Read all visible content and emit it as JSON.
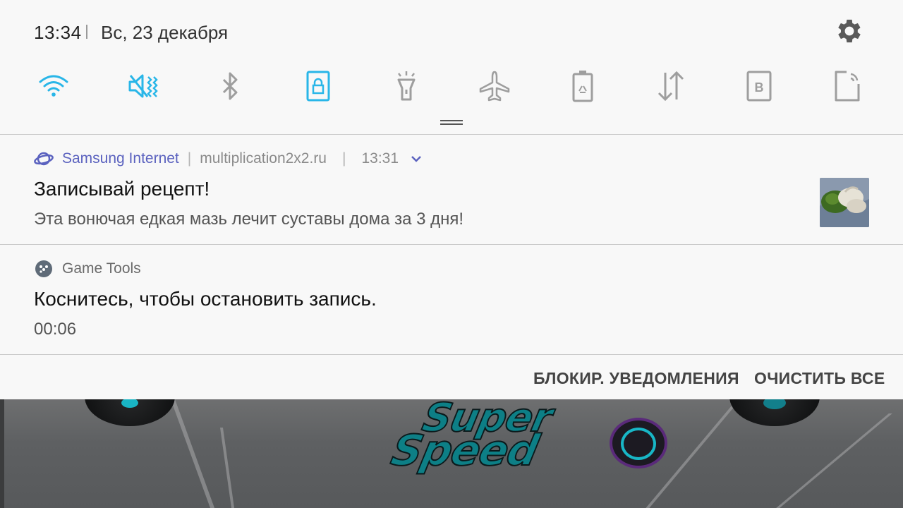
{
  "status_bar": {
    "time": "13:34",
    "date": "Вс, 23 декабря"
  },
  "quick_settings": [
    {
      "name": "wifi",
      "icon": "wifi-icon",
      "active": true
    },
    {
      "name": "sound",
      "icon": "vibrate-mute-icon",
      "active": true
    },
    {
      "name": "bluetooth",
      "icon": "bluetooth-icon",
      "active": false
    },
    {
      "name": "rotation_lock",
      "icon": "rotation-lock-icon",
      "active": true
    },
    {
      "name": "flashlight",
      "icon": "flashlight-icon",
      "active": false
    },
    {
      "name": "airplane",
      "icon": "airplane-icon",
      "active": false
    },
    {
      "name": "power_saving",
      "icon": "battery-saver-icon",
      "active": false
    },
    {
      "name": "mobile_data",
      "icon": "data-arrows-icon",
      "active": false
    },
    {
      "name": "blue_light",
      "icon": "blue-light-filter-icon",
      "active": false
    },
    {
      "name": "nfc",
      "icon": "nfc-icon",
      "active": false
    }
  ],
  "colors": {
    "accent_active": "#29b6e8",
    "inactive_icon": "#9e9e9e",
    "samsung_app": "#5b62bf"
  },
  "notifications": [
    {
      "app": "Samsung Internet",
      "source": "multiplication2x2.ru",
      "time": "13:31",
      "title": "Записывай рецепт!",
      "text": "Эта вонючая едкая мазь лечит суставы дома за 3 дня!",
      "has_thumbnail": true
    },
    {
      "app": "Game Tools",
      "title": "Коснитесь, чтобы остановить запись.",
      "text": "00:06"
    }
  ],
  "actions": {
    "block": "БЛОКИР. УВЕДОМЛЕНИЯ",
    "clear": "ОЧИСТИТЬ ВСЕ"
  },
  "game": {
    "logo_line1": "Super",
    "logo_line2": "Speed"
  }
}
